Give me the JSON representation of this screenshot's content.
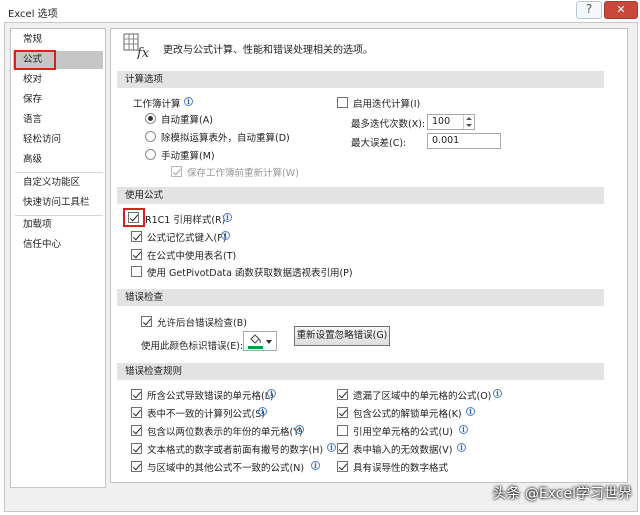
{
  "window": {
    "title": "Excel 选项",
    "help_glyph": "?",
    "close_glyph": "✕"
  },
  "nav": {
    "items": [
      "常规",
      "公式",
      "校对",
      "保存",
      "语言",
      "轻松访问",
      "高级",
      "自定义功能区",
      "快速访问工具栏",
      "加载项",
      "信任中心"
    ],
    "selected": "公式"
  },
  "header": {
    "text": "更改与公式计算、性能和错误处理相关的选项。"
  },
  "calc": {
    "title": "计算选项",
    "workbook_label": "工作簿计算",
    "auto": "自动重算(A)",
    "auto_except": "除模拟运算表外，自动重算(D)",
    "manual": "手动重算(M)",
    "recalc_before_save": "保存工作簿前重新计算(W)",
    "enable_iter": "启用迭代计算(I)",
    "max_iter_label": "最多迭代次数(X):",
    "max_iter_value": "100",
    "max_change_label": "最大误差(C):",
    "max_change_value": "0.001"
  },
  "formulas": {
    "title": "使用公式",
    "r1c1": "R1C1 引用样式(R)",
    "autocomplete": "公式记忆式键入(F)",
    "table_names": "在公式中使用表名(T)",
    "getpivotdata": "使用 GetPivotData 函数获取数据透视表引用(P)"
  },
  "errorcheck": {
    "title": "错误检查",
    "enable_bg": "允许后台错误检查(B)",
    "color_label": "使用此颜色标识错误(E):",
    "reset_button": "重新设置忽略错误(G)",
    "indicator_color": "#00a046"
  },
  "rules": {
    "title": "错误检查规则",
    "left": [
      "所含公式导致错误的单元格(L)",
      "表中不一致的计算列公式(S)",
      "包含以两位数表示的年份的单元格(Y)",
      "文本格式的数字或者前面有撇号的数字(H)",
      "与区域中的其他公式不一致的公式(N)"
    ],
    "right": [
      "遗漏了区域中的单元格的公式(O)",
      "包含公式的解锁单元格(K)",
      "引用空单元格的公式(U)",
      "表中输入的无效数据(V)",
      "具有误导性的数字格式"
    ]
  },
  "watermark": "头条 @Excel学习世界",
  "colors": {
    "highlight_red": "#e01e1e",
    "section_bg": "#e3e3e3",
    "nav_selected": "#c6c6c6"
  }
}
